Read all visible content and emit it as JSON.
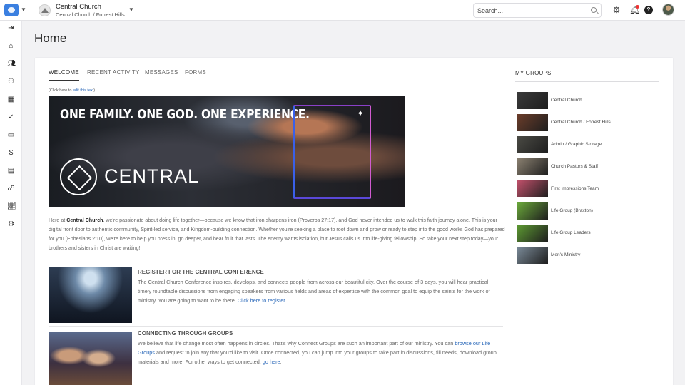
{
  "header": {
    "church_name": "Central Church",
    "church_path": "Central Church / Forrest Hills",
    "search_placeholder": "Search..."
  },
  "icons": {
    "top": [
      "app-icon",
      "church-logo",
      "search-icon",
      "gear-icon",
      "bell-icon",
      "help-icon",
      "avatar"
    ],
    "sidebar": [
      "collapse-icon",
      "home-icon",
      "people-icon",
      "groups-icon",
      "calendar-icon",
      "check-icon",
      "forms-icon",
      "giving-icon",
      "clipboard-icon",
      "chat-icon",
      "reports-icon",
      "settings-icon"
    ]
  },
  "page": {
    "title": "Home"
  },
  "tabs": [
    "WELCOME",
    "RECENT ACTIVITY",
    "MESSAGES",
    "FORMS"
  ],
  "welcome": {
    "edit_prefix": "(Click here to ",
    "edit_link": "edit this text",
    "edit_suffix": ")",
    "hero_headline": "ONE FAMILY.  ONE GOD.  ONE EXPERIENCE.",
    "hero_word": "CENTRAL",
    "intro_prefix": "Here at ",
    "intro_bold": "Central Church",
    "intro_text": ", we're passionate about doing life together—because we know that iron sharpens iron (Proverbs 27:17), and God never intended us to walk this faith journey alone. This is your digital front door to authentic community, Spirit-led service, and Kingdom-building connection. Whether you're seeking a place to root down and grow or ready to step into the good works God has prepared for you (Ephesians 2:10), we're here to help you press in, go deeper, and bear fruit that lasts. The enemy wants isolation, but Jesus calls us into life-giving fellowship. So take your next step today—your brothers and sisters in Christ are waiting!",
    "sections": [
      {
        "title": "REGISTER FOR THE CENTRAL CONFERENCE",
        "body": "The Central Church Conference inspires, develops, and connects people from across our beautiful city. Over the course of 3 days, you will hear practical, timely roundtable discussions from engaging speakers from various fields and areas of expertise with the common goal to equip the saints for the work of ministry. You are going to want to be there. ",
        "link": "Click here to register",
        "suffix": ""
      },
      {
        "title": "CONNECTING THROUGH GROUPS",
        "body": "We believe that life change most often happens in circles. That's why Connect Groups are such an important part of our ministry. You can ",
        "link": "browse our Life Groups",
        "middle": " and request to join any that you'd like to visit. Once connected, you can jump into your groups to take part in discussions, fill needs, download group materials and more. For other ways to get connected, ",
        "link2": "go here",
        "suffix": "."
      }
    ]
  },
  "my_groups": {
    "title": "MY GROUPS",
    "items": [
      {
        "label": "Central Church",
        "color": "#3a3a3a"
      },
      {
        "label": "Central Church / Forrest Hills",
        "color": "#6b3d2a"
      },
      {
        "label": "Admin / Graphic Storage",
        "color": "#4a4a44"
      },
      {
        "label": "Church Pastors & Staff",
        "color": "#8a8070"
      },
      {
        "label": "First Impressions Team",
        "color": "#c0506a"
      },
      {
        "label": "Life Group (Braxton)",
        "color": "#6aa83a"
      },
      {
        "label": "Life Group Leaders",
        "color": "#5d9a32"
      },
      {
        "label": "Men's Ministry",
        "color": "#7a8a98"
      }
    ]
  }
}
